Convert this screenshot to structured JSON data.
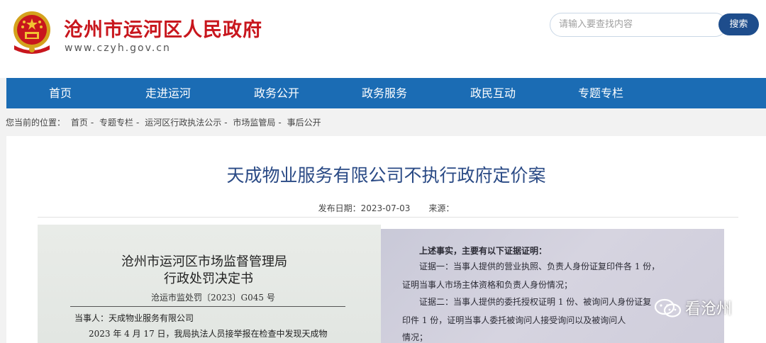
{
  "header": {
    "site_name": "沧州市运河区人民政府",
    "site_url": "www.czyh.gov.cn",
    "search_placeholder": "请输入要查找内容",
    "search_button": "搜索"
  },
  "nav": {
    "items": [
      "首页",
      "走进运河",
      "政务公开",
      "政务服务",
      "政民互动",
      "专题专栏"
    ]
  },
  "breadcrumb": {
    "prefix": "您当前的位置：",
    "items": [
      "首页",
      "专题专栏",
      "运河区行政执法公示",
      "市场监管局",
      "事后公开"
    ],
    "separator": "-"
  },
  "article": {
    "title": "天成物业服务有限公司不执行政府定价案",
    "date_label": "发布日期：",
    "date": "2023-07-03",
    "source_label": "来源："
  },
  "document_left": {
    "title_line1": "沧州市运河区市场监督管理局",
    "title_line2": "行政处罚决定书",
    "doc_number": "沧运市监处罚〔2023〕G045 号",
    "party": "当事人：天成物业服务有限公司",
    "line1": "2023 年 4 月 17 日，我局执法人员接举报在检查中发现天成物"
  },
  "document_right": {
    "lines": [
      "上述事实，主要有以下证据证明：",
      "证据一：当事人提供的营业执照、负责人身份证复印件各 1 份，",
      "证明当事人市场主体资格和负责人身份情况；",
      "证据二：当事人提供的委托授权证明 1 份、被询问人身份证复",
      "印件 1 份，证明当事人委托被询问人接受询问以及被询问人",
      "情况；"
    ]
  },
  "watermark": {
    "text": "看沧州",
    "icon": "wechat-icon"
  },
  "colors": {
    "brand_red": "#c8161d",
    "nav_blue": "#1b6cb4",
    "title_blue": "#2a4a85",
    "search_button": "#1e4d8c"
  }
}
